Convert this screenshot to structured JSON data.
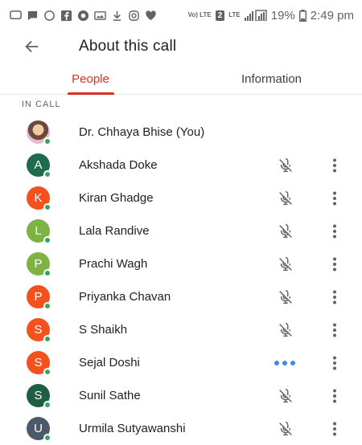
{
  "status_bar": {
    "battery_percent": "19%",
    "time": "2:49 pm",
    "volte_label": "Vo) LTE",
    "sim_label": "2",
    "lte_label": "LTE"
  },
  "header": {
    "title": "About this call"
  },
  "tabs": [
    {
      "label": "People",
      "active": true
    },
    {
      "label": "Information",
      "active": false
    }
  ],
  "section": {
    "label": "IN CALL"
  },
  "participants": [
    {
      "name": "Dr. Chhaya Bhise (You)",
      "initial": "",
      "avatar_color": "#f1c9a5",
      "status": "none",
      "photo": true
    },
    {
      "name": "Akshada Doke",
      "initial": "A",
      "avatar_color": "#1e6b4f",
      "status": "muted"
    },
    {
      "name": "Kiran Ghadge",
      "initial": "K",
      "avatar_color": "#f4511e",
      "status": "muted"
    },
    {
      "name": "Lala Randive",
      "initial": "L",
      "avatar_color": "#7cb342",
      "status": "muted"
    },
    {
      "name": "Prachi Wagh",
      "initial": "P",
      "avatar_color": "#7cb342",
      "status": "muted"
    },
    {
      "name": "Priyanka Chavan",
      "initial": "P",
      "avatar_color": "#f4511e",
      "status": "muted"
    },
    {
      "name": "S Shaikh",
      "initial": "S",
      "avatar_color": "#f4511e",
      "status": "muted"
    },
    {
      "name": "Sejal Doshi",
      "initial": "S",
      "avatar_color": "#f4511e",
      "status": "speaking"
    },
    {
      "name": "Sunil Sathe",
      "initial": "S",
      "avatar_color": "#1e5e45",
      "status": "muted"
    },
    {
      "name": "Urmila Sutyawanshi",
      "initial": "U",
      "avatar_color": "#4a5a6a",
      "status": "muted"
    }
  ],
  "colors": {
    "accent": "#d93025",
    "online": "#34a853",
    "speaking": "#4285f4"
  }
}
